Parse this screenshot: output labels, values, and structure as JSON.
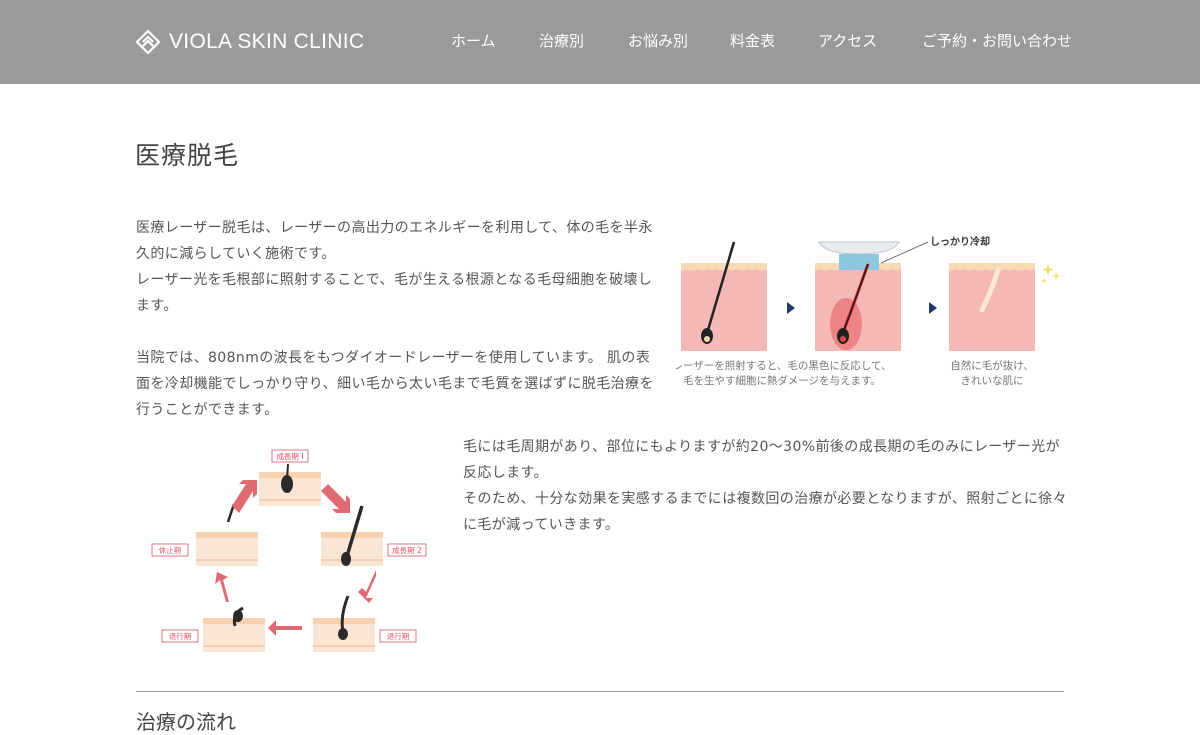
{
  "header": {
    "logo_text": "VIOLA SKIN CLINIC",
    "nav": [
      "ホーム",
      "治療別",
      "お悩み別",
      "料金表",
      "アクセス",
      "ご予約・お問い合わせ"
    ]
  },
  "main": {
    "title": "医療脱毛",
    "paragraph1": "医療レーザー脱毛は、レーザーの高出力のエネルギーを利用して、体の毛を半永久的に減らしていく施術です。\nレーザー光を毛根部に照射することで、毛が生える根源となる毛母細胞を破壊します。\n\n当院では、808nmの波長をもつダイオードレーザーを使用しています。 肌の表面を冷却機能でしっかり守り、細い毛から太い毛まで毛質を選ばずに脱毛治療を行うことができます。",
    "paragraph2": "毛には毛周期があり、部位にもよりますが約20〜30%前後の成長期の毛のみにレーザー光が反応します。\nそのため、十分な効果を実感するまでには複数回の治療が必要となりますが、照射ごとに徐々に毛が減っていきます。",
    "diagram1": {
      "cooling_label": "しっかり冷却",
      "caption_left_1": "レーザーを照射すると、毛の黒色に反応して、",
      "caption_left_2": "毛を生やす細胞に熱ダメージを与えます。",
      "caption_right_1": "自然に毛が抜け、",
      "caption_right_2": "きれいな肌に"
    },
    "diagram2": {
      "stage_growth1": "成長期 I",
      "stage_growth2": "成長期 2",
      "stage_regression1": "退行期",
      "stage_regression2": "退行期",
      "stage_rest": "休止期"
    },
    "next_heading": "治療の流れ"
  },
  "colors": {
    "header_bg": "#9a9a9a",
    "skin": "#f4b8b6",
    "skin_top": "#f7d9b3",
    "arrow_dark": "#1f3a6e",
    "arrow_red": "#e06a72",
    "laser_red": "#e0202a"
  }
}
